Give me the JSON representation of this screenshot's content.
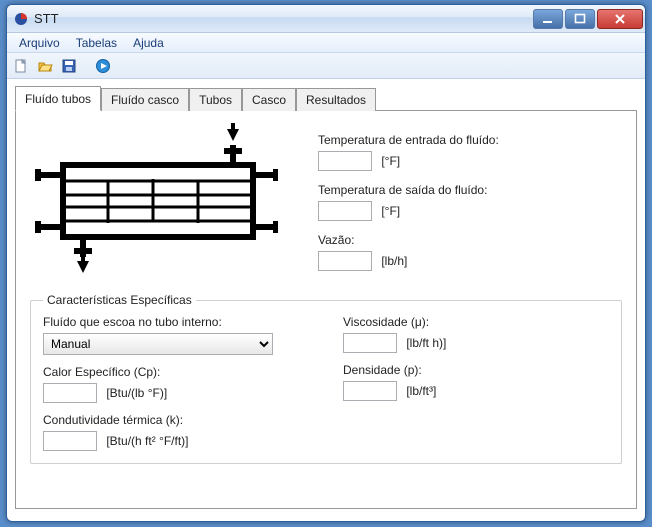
{
  "window": {
    "title": "STT"
  },
  "menu": {
    "arquivo": "Arquivo",
    "tabelas": "Tabelas",
    "ajuda": "Ajuda"
  },
  "tabs": {
    "fluido_tubos": "Fluído tubos",
    "fluido_casco": "Fluído casco",
    "tubos": "Tubos",
    "casco": "Casco",
    "resultados": "Resultados"
  },
  "right": {
    "temp_in_label": "Temperatura de entrada do fluído:",
    "temp_in_value": "",
    "temp_in_unit": "[°F]",
    "temp_out_label": "Temperatura de saída do fluído:",
    "temp_out_value": "",
    "temp_out_unit": "[°F]",
    "vazao_label": "Vazão:",
    "vazao_value": "",
    "vazao_unit": "[lb/h]"
  },
  "group": {
    "legend": "Características Específicas",
    "fluido_label": "Fluído que escoa no tubo interno:",
    "fluido_selected": "Manual",
    "cp_label": "Calor Específico (Cp):",
    "cp_value": "",
    "cp_unit": "[Btu/(lb °F)]",
    "k_label": "Condutividade térmica (k):",
    "k_value": "",
    "k_unit": "[Btu/(h ft² °F/ft)]",
    "visc_label": "Viscosidade (μ):",
    "visc_value": "",
    "visc_unit": "[lb/ft h)]",
    "dens_label": "Densidade (p):",
    "dens_value": "",
    "dens_unit": "[lb/ft³]"
  }
}
